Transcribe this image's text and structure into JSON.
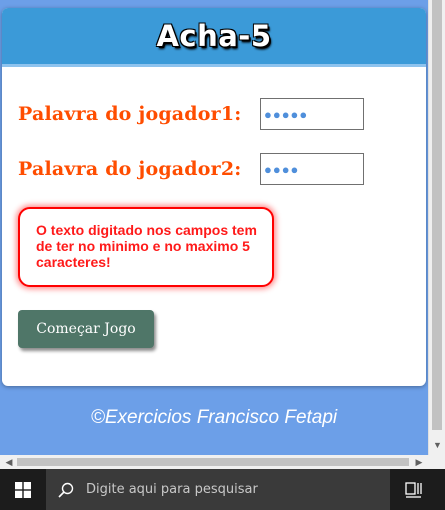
{
  "app": {
    "title": "Acha-5"
  },
  "form": {
    "player1_label": "Palavra do jogador1:",
    "player1_value": "●●●●●",
    "player2_label": "Palavra do jogador2:",
    "player2_value": "●●●●"
  },
  "message": {
    "error": "O texto digitado nos campos tem de ter no minimo e no maximo 5 caracteres!"
  },
  "actions": {
    "start_label": "Começar Jogo"
  },
  "footer": {
    "credit": "©Exercicios Francisco Fetapi"
  },
  "taskbar": {
    "search_placeholder": "Digite aqui para pesquisar"
  },
  "colors": {
    "page_bg": "#6c9fe8",
    "header_bg": "#3b9ad8",
    "label": "#ff4d00",
    "error": "#ff1a1a",
    "button_bg": "#4f7668"
  }
}
